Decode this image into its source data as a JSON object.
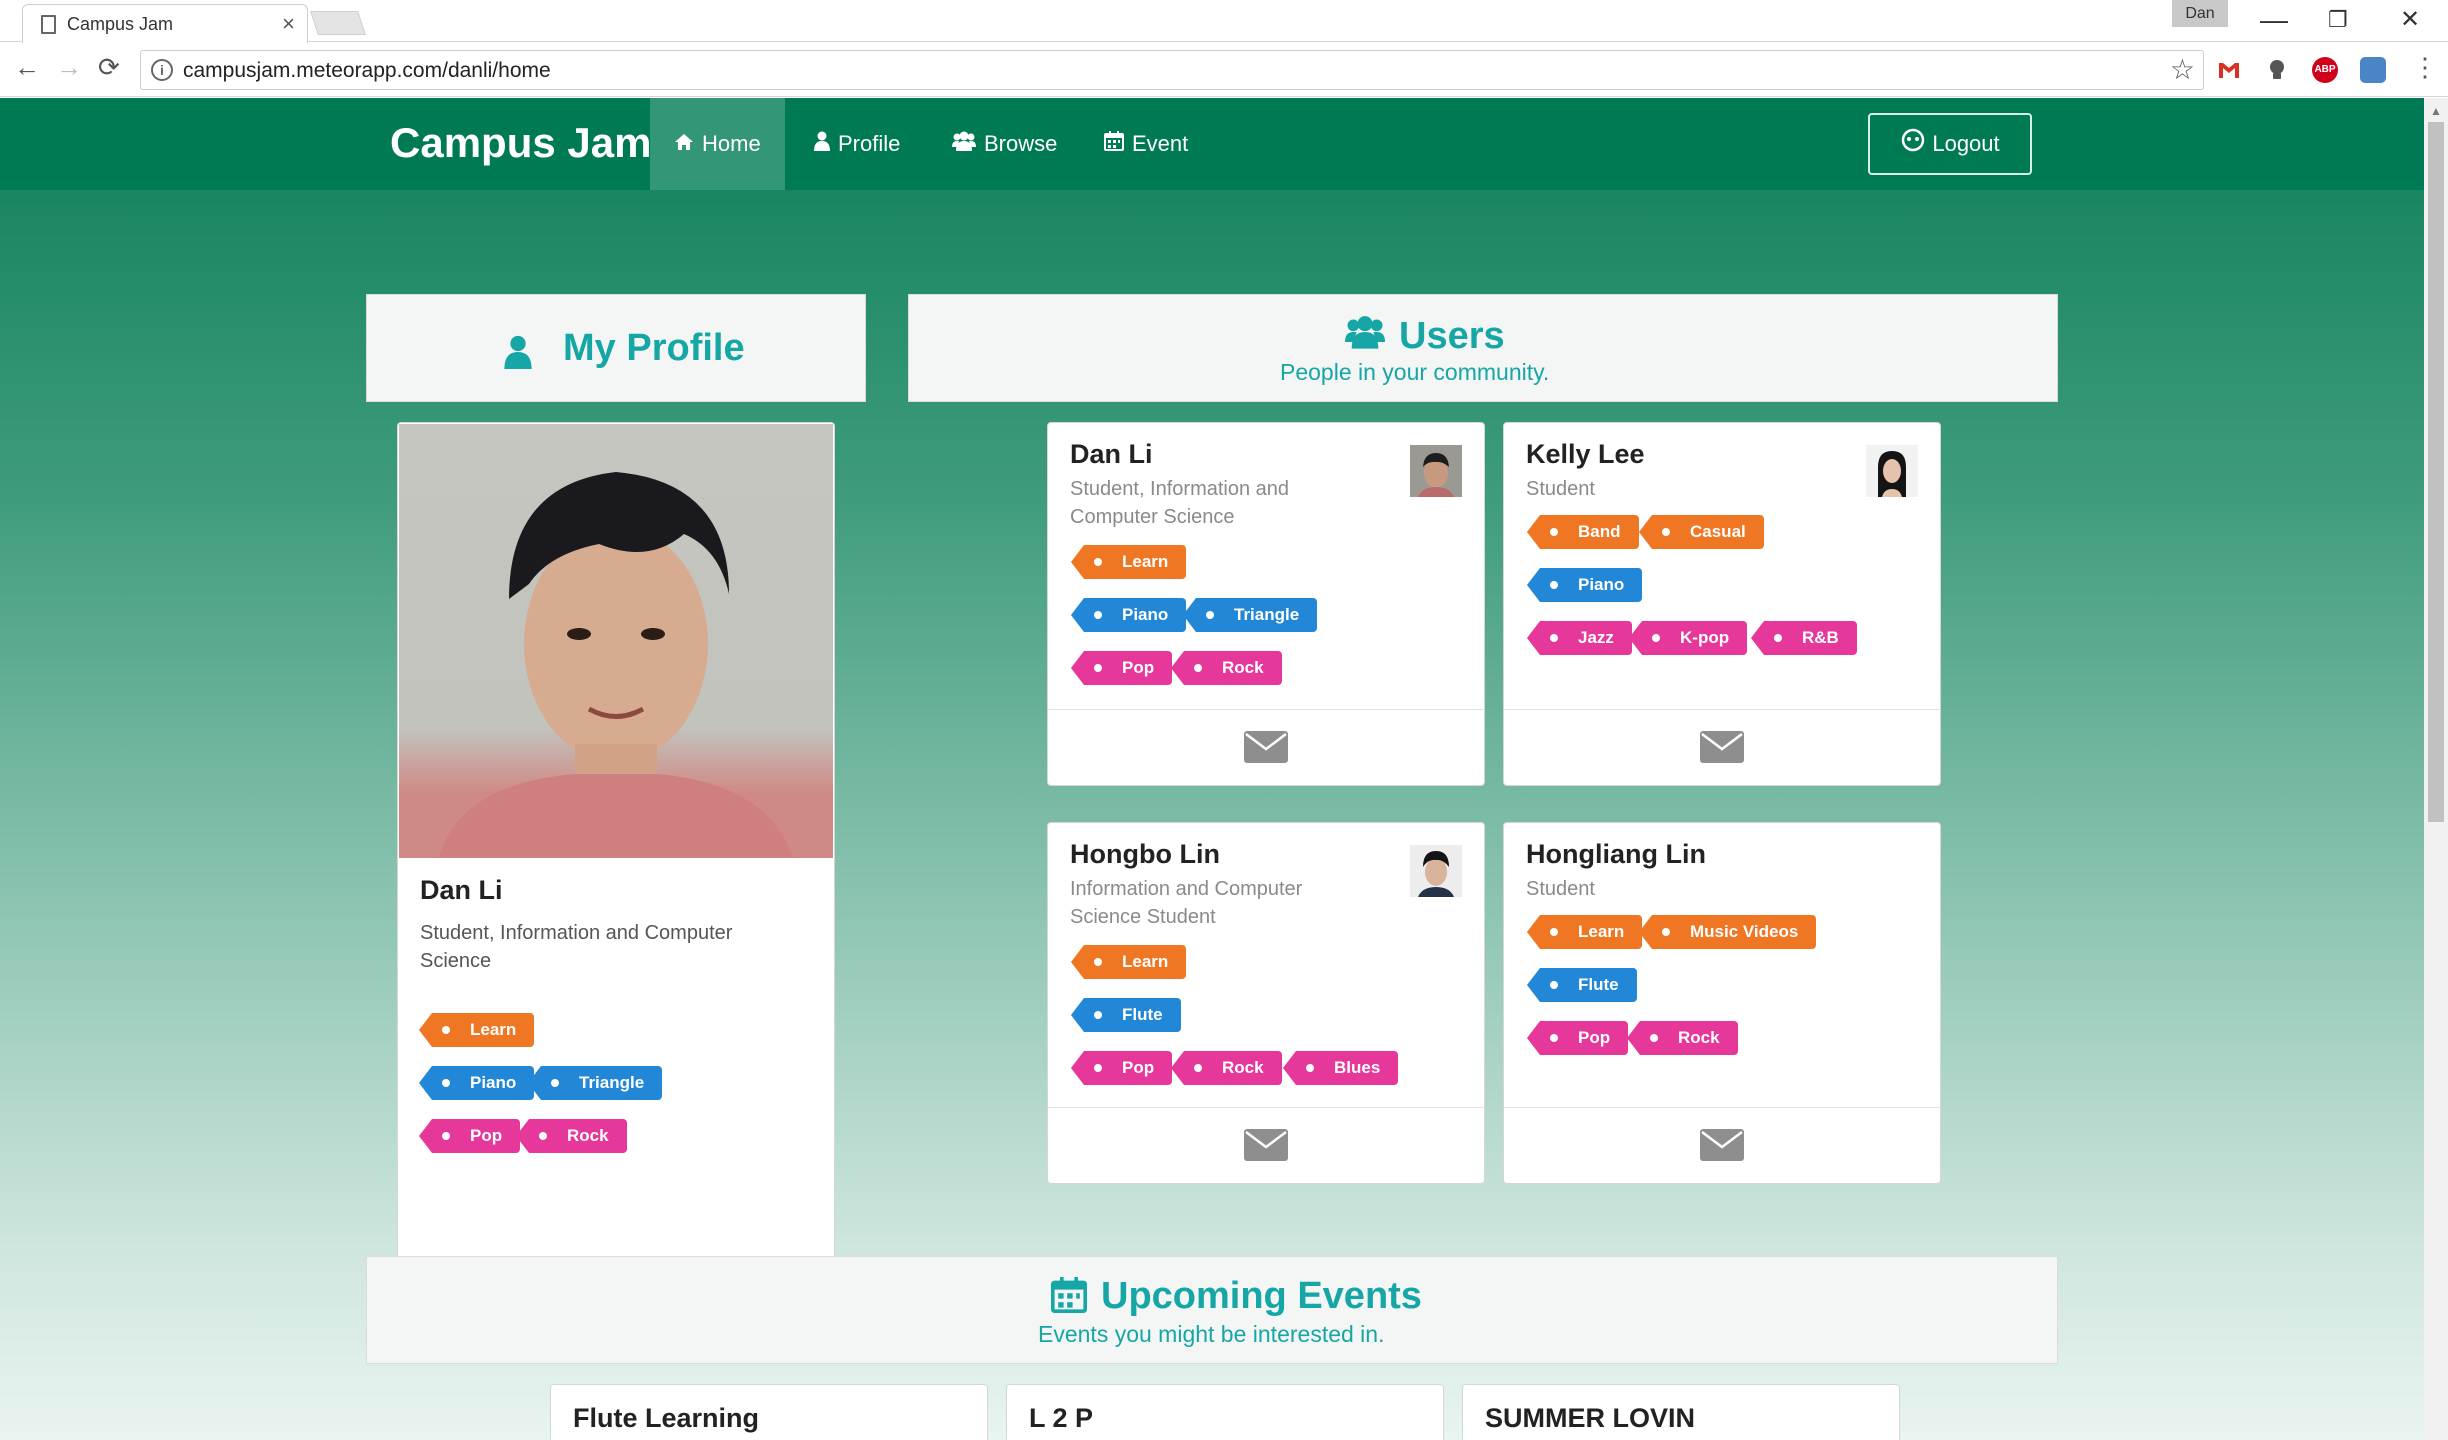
{
  "browser": {
    "tab_title": "Campus Jam",
    "tab_close": "×",
    "user_chip": "Dan",
    "url": "campusjam.meteorapp.com/danli/home",
    "extensions": [
      "gmail-icon",
      "lightbulb-icon",
      "adblock-icon",
      "translate-icon"
    ],
    "extension_labels": {
      "adblock": "ABP"
    },
    "window_controls": {
      "minimize": "—",
      "restore": "❐",
      "close": "✕"
    },
    "nav": {
      "back": "←",
      "forward": "→",
      "reload": "⟳",
      "star": "☆",
      "menu": "⋮"
    }
  },
  "app": {
    "brand": "Campus Jam",
    "nav": [
      {
        "label": "Home",
        "icon": "home-icon"
      },
      {
        "label": "Profile",
        "icon": "user-icon"
      },
      {
        "label": "Browse",
        "icon": "users-icon"
      },
      {
        "label": "Event",
        "icon": "calendar-icon"
      }
    ],
    "logout": "Logout",
    "colors": {
      "nav": "#007a55",
      "accent": "#16a6a6",
      "learn": "#ef7623",
      "instrument": "#2287d6",
      "genre": "#e6379a"
    }
  },
  "my_profile": {
    "heading": "My Profile",
    "name": "Dan Li",
    "subtitle": "Student, Information and Computer Science",
    "tags": {
      "goals": [
        "Learn"
      ],
      "instruments": [
        "Piano",
        "Triangle"
      ],
      "genres": [
        "Pop",
        "Rock"
      ]
    }
  },
  "users": {
    "heading": "Users",
    "subheading": "People in your community.",
    "cards": [
      {
        "name": "Dan Li",
        "subtitle": "Student, Information and Computer Science",
        "goals": [
          "Learn"
        ],
        "instruments": [
          "Piano",
          "Triangle"
        ],
        "genres": [
          "Pop",
          "Rock"
        ]
      },
      {
        "name": "Kelly Lee",
        "subtitle": "Student",
        "goals": [
          "Band",
          "Casual"
        ],
        "instruments": [
          "Piano"
        ],
        "genres": [
          "Jazz",
          "K-pop",
          "R&B"
        ]
      },
      {
        "name": "Hongbo Lin",
        "subtitle": "Information and Computer Science Student",
        "goals": [
          "Learn"
        ],
        "instruments": [
          "Flute"
        ],
        "genres": [
          "Pop",
          "Rock",
          "Blues"
        ]
      },
      {
        "name": "Hongliang Lin",
        "subtitle": "Student",
        "goals": [
          "Learn",
          "Music Videos"
        ],
        "instruments": [
          "Flute"
        ],
        "genres": [
          "Pop",
          "Rock"
        ]
      }
    ]
  },
  "events": {
    "heading": "Upcoming Events",
    "subheading": "Events you might be interested in.",
    "items": [
      "Flute Learning",
      "L 2 P",
      "SUMMER LOVIN"
    ]
  }
}
